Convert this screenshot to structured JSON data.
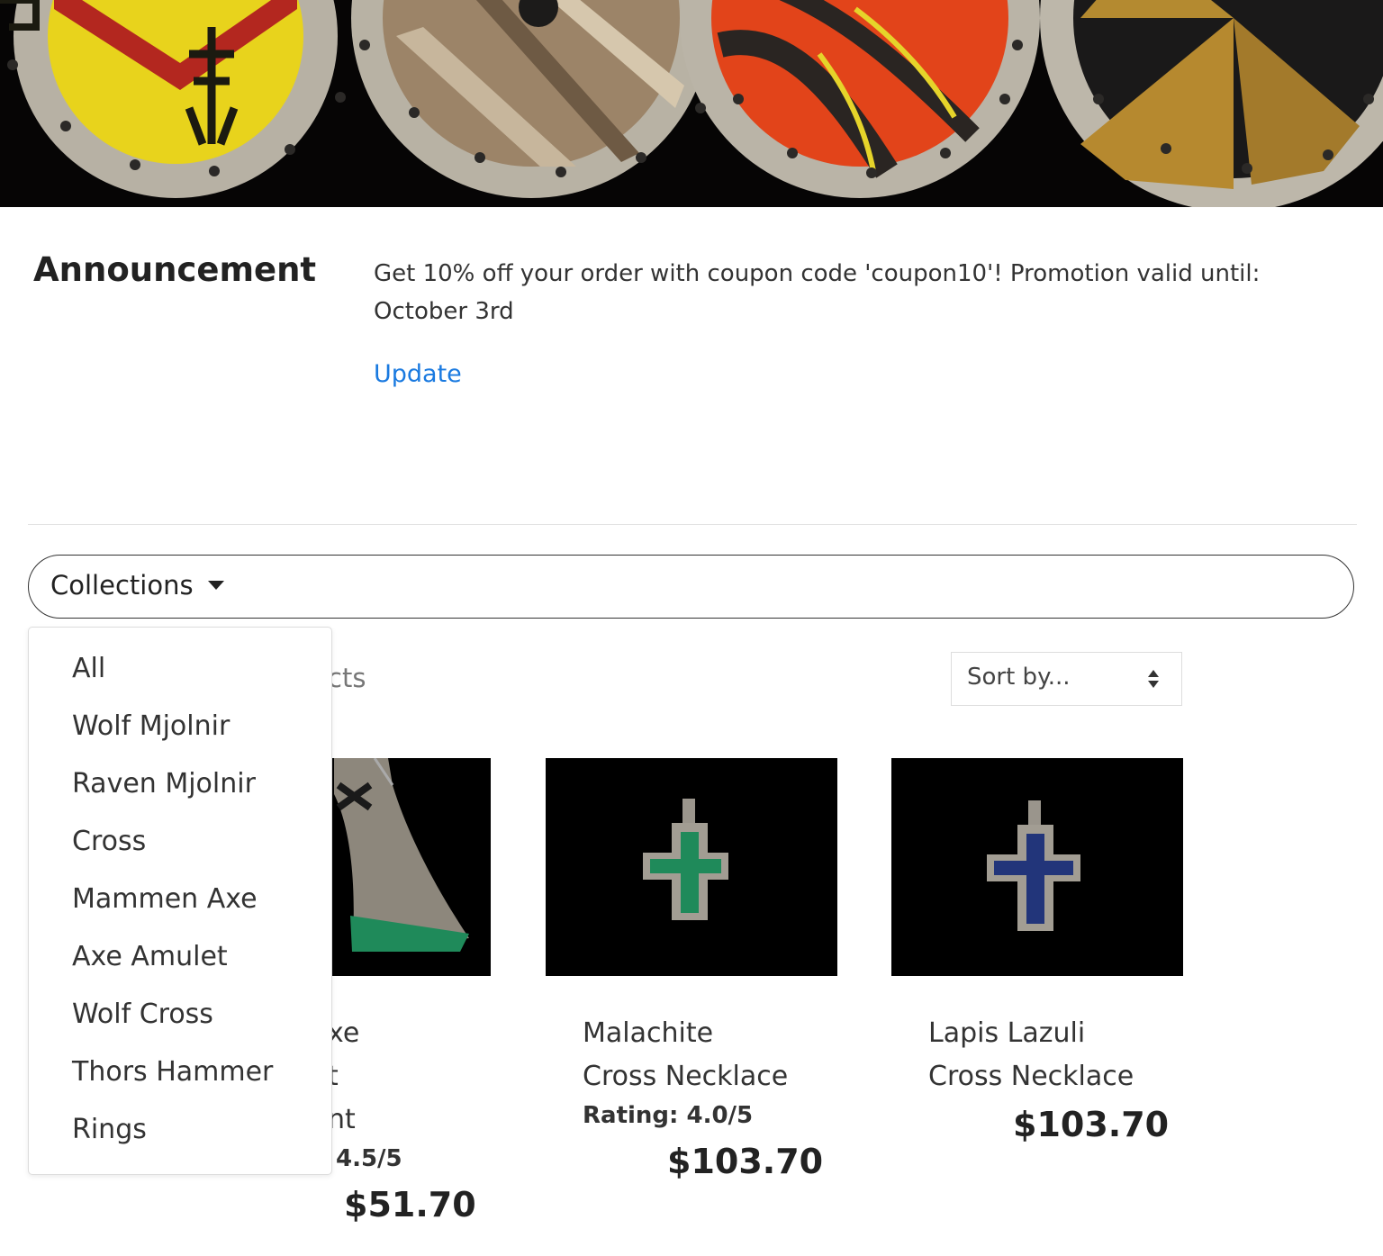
{
  "announcement": {
    "heading": "Announcement",
    "message": "Get 10% off your order with coupon code 'coupon10'! Promotion valid until: October 3rd",
    "link_label": "Update"
  },
  "collections": {
    "button_label": "Collections",
    "menu_items": [
      "All",
      "Wolf Mjolnir",
      "Raven Mjolnir",
      "Cross",
      "Mammen Axe",
      "Axe Amulet",
      "Wolf Cross",
      "Thors Hammer",
      "Rings"
    ]
  },
  "listing": {
    "count_text_visible": "cts",
    "sort_placeholder": "Sort by..."
  },
  "products": [
    {
      "name_line1": "xe",
      "name_line2": "t",
      "name_line3": "nt",
      "rating": "4.5/5",
      "price": "$51.70"
    },
    {
      "name_line1": "Malachite",
      "name_line2": "Cross Necklace",
      "rating": "Rating: 4.0/5",
      "price": "$103.70"
    },
    {
      "name_line1": "Lapis Lazuli",
      "name_line2": "Cross Necklace",
      "price": "$103.70"
    }
  ],
  "colors": {
    "link": "#1a7ae0",
    "malachite": "#1f8a5a",
    "lapis": "#22357a"
  }
}
